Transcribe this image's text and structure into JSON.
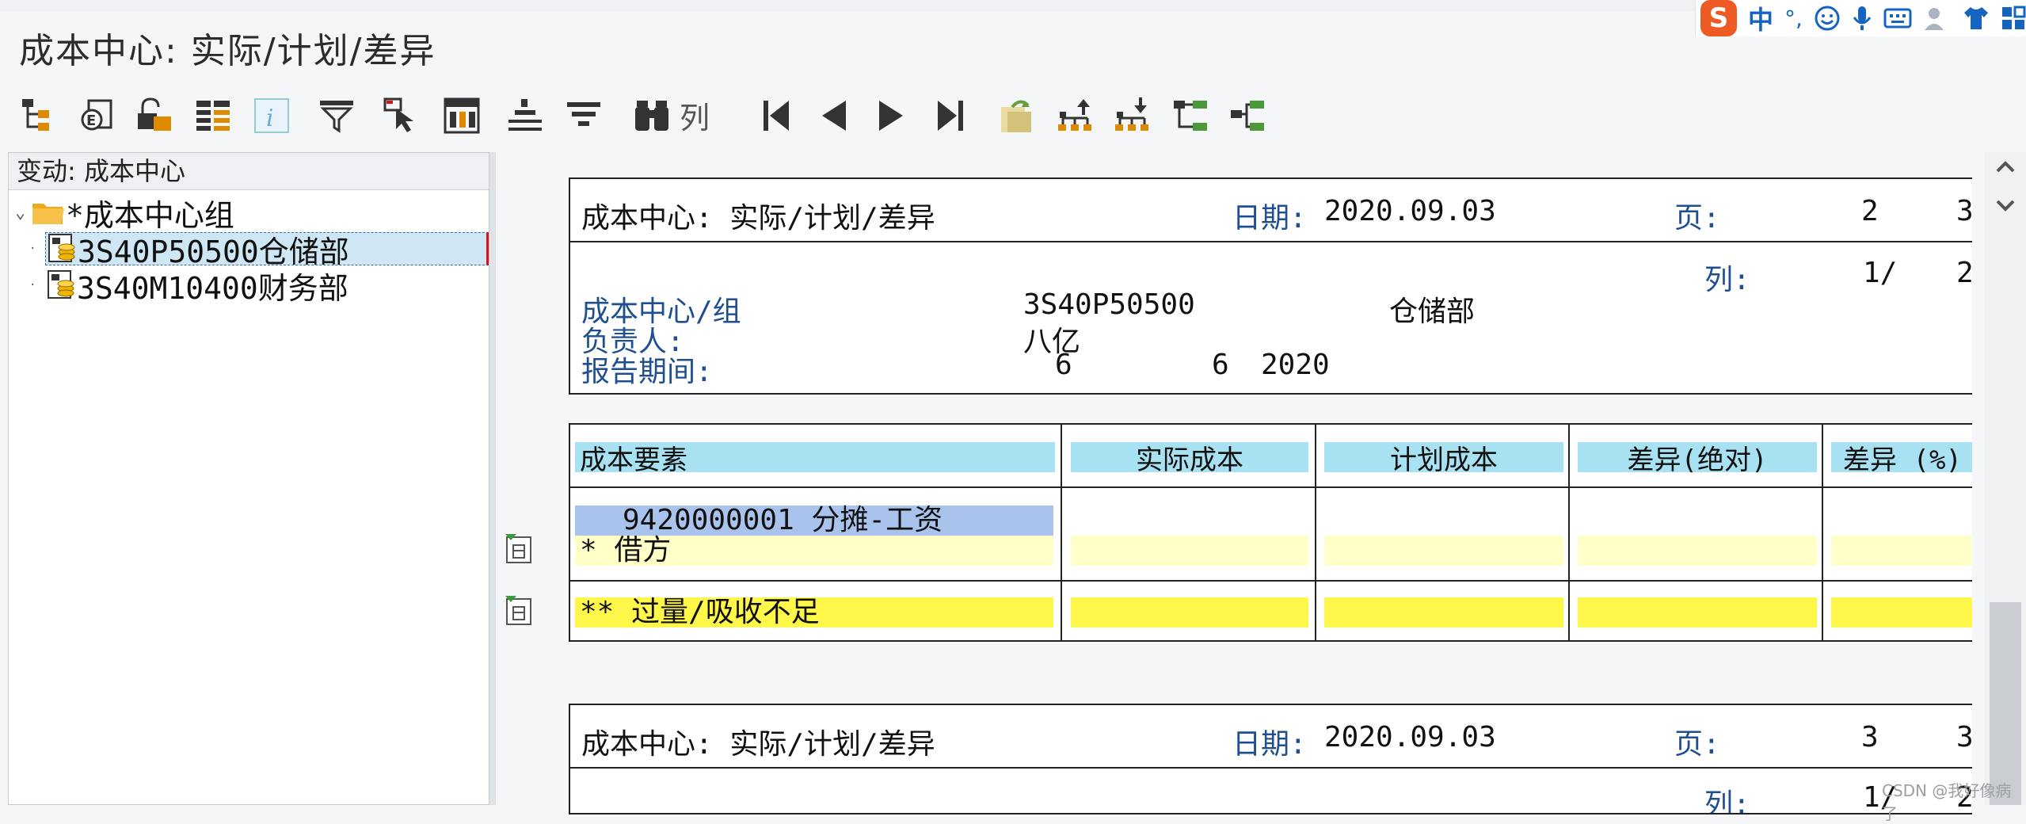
{
  "window": {
    "title": "成本中心: 实际/计划/差异"
  },
  "ime": {
    "logo": "S",
    "mode": "中",
    "punct": "°,"
  },
  "toolbar": {
    "columns_label": "列"
  },
  "tree": {
    "header": "变动:  成本中心",
    "root_label": "*成本中心组",
    "items": [
      {
        "label": "3S40P50500仓储部"
      },
      {
        "label": "3S40M10400财务部"
      }
    ]
  },
  "report": {
    "pages": [
      {
        "title": "成本中心: 实际/计划/差异",
        "date_label": "日期:",
        "date": "2020.09.03",
        "page_label": "页:",
        "page_num": "2",
        "page_total": "3",
        "col_label": "列:",
        "col_num": "1/",
        "col_total": "2",
        "fields": [
          {
            "label": "成本中心/组",
            "value": "3S40P50500",
            "value2": "仓储部"
          },
          {
            "label": "负责人:",
            "value": "八亿",
            "value2": ""
          },
          {
            "label": "报告期间:",
            "value": "6",
            "value2": "6",
            "value3": "2020"
          }
        ],
        "table": {
          "headers": [
            "成本要素",
            "实际成本",
            "计划成本",
            "差异(绝对)",
            "差异 (%)"
          ],
          "element_row": "9420000001  分摊-工资",
          "debit_row": "*  借方",
          "total_row": "** 过量/吸收不足"
        }
      },
      {
        "title": "成本中心: 实际/计划/差异",
        "date_label": "日期:",
        "date": "2020.09.03",
        "page_label": "页:",
        "page_num": "3",
        "page_total": "3",
        "col_label": "列:",
        "col_num": "1/",
        "col_total": "2"
      }
    ]
  },
  "watermark": "CSDN @我好像病了",
  "colors": {
    "header_cyan": "#a8e2f2",
    "element_blue": "#a9c3ec",
    "debit_yellow": "#ffffc8",
    "total_yellow": "#fff74a",
    "label_blue": "#1f4f8f"
  }
}
